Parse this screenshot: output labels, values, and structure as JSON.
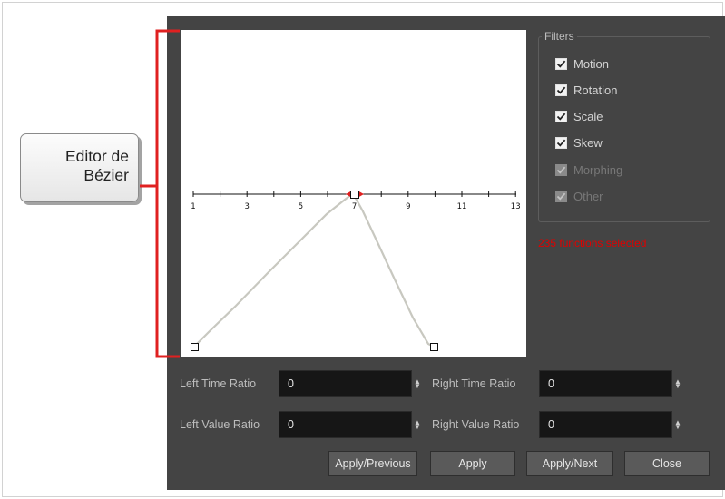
{
  "callout": {
    "line1": "Editor de",
    "line2": "Bézier",
    "accent_color": "#e02020"
  },
  "timeline": {
    "labels": [
      "1",
      "3",
      "5",
      "7",
      "9",
      "11",
      "13"
    ],
    "curve_color": "#c8c8c0",
    "handle_color": "#e02020"
  },
  "filters": {
    "title": "Filters",
    "items": [
      {
        "label": "Motion",
        "checked": true,
        "enabled": true
      },
      {
        "label": "Rotation",
        "checked": true,
        "enabled": true
      },
      {
        "label": "Scale",
        "checked": true,
        "enabled": true
      },
      {
        "label": "Skew",
        "checked": true,
        "enabled": true
      },
      {
        "label": "Morphing",
        "checked": true,
        "enabled": false
      },
      {
        "label": "Other",
        "checked": true,
        "enabled": false
      }
    ]
  },
  "status": {
    "text": "235 functions selected",
    "color": "#e00000"
  },
  "fields": {
    "left_time_ratio": {
      "label": "Left Time Ratio",
      "value": "0"
    },
    "right_time_ratio": {
      "label": "Right Time Ratio",
      "value": "0"
    },
    "left_value_ratio": {
      "label": "Left Value Ratio",
      "value": "0"
    },
    "right_value_ratio": {
      "label": "Right Value Ratio",
      "value": "0"
    }
  },
  "buttons": {
    "apply_previous": "Apply/Previous",
    "apply": "Apply",
    "apply_next": "Apply/Next",
    "close": "Close"
  }
}
